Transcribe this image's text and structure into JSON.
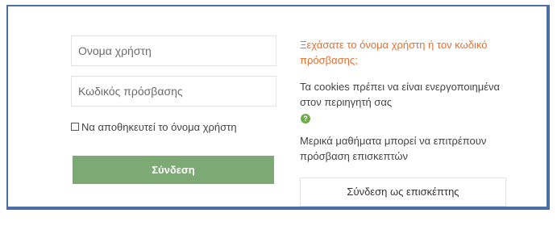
{
  "login": {
    "username_placeholder": "Ονομα χρήστη",
    "password_placeholder": "Κωδικός πρόσβασης",
    "remember_label": "Να αποθηκευτεί το όνομα χρήστη",
    "login_button": "Σύνδεση"
  },
  "info": {
    "forgot_link": "Ξεχάσατε το όνομα χρήστη ή τον κωδικό πρόσβασης;",
    "cookies_text": "Τα cookies πρέπει να είναι ενεργοποιημένα στον περιηγητή σας",
    "help_icon_glyph": "?",
    "guest_text": "Μερικά μαθήματα μπορεί να επιτρέπουν πρόσβαση επισκεπτών",
    "guest_button": "Σύνδεση ως επισκέπτης"
  },
  "colors": {
    "frame_border": "#4a6fa5",
    "login_button_bg": "#7daa74",
    "link_color": "#e4702f",
    "help_icon_bg": "#6eac4a"
  }
}
